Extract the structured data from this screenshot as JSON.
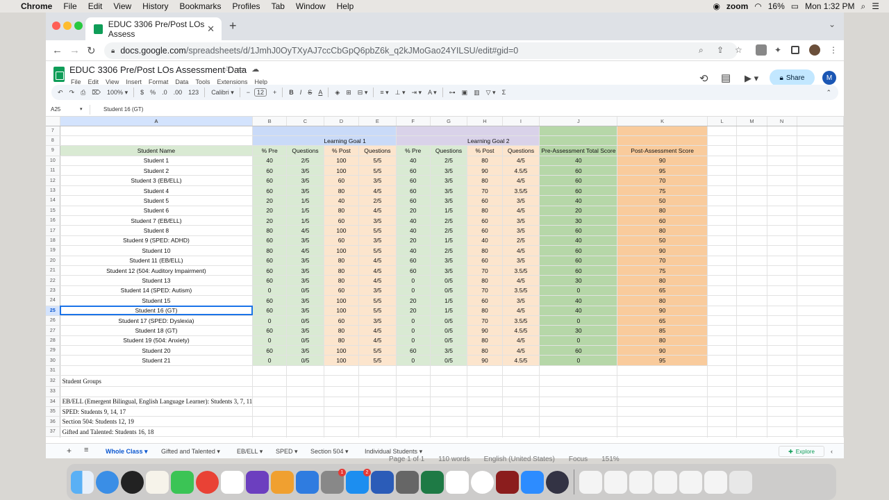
{
  "menubar": {
    "apple": "",
    "app": "Chrome",
    "items": [
      "File",
      "Edit",
      "View",
      "History",
      "Bookmarks",
      "Profiles",
      "Tab",
      "Window",
      "Help"
    ],
    "zoom": "zoom",
    "battery": "16%",
    "clock": "Mon 1:32 PM"
  },
  "browser": {
    "tab_title": "EDUC 3306 Pre/Post LOs Assess",
    "url_host": "docs.google.com",
    "url_rest": "/spreadsheets/d/1JmhJ0OyTXyAJ7ccCbGpQ6pbZ6k_q2kJMoGao24YILSU/edit#gid=0",
    "avatar": "M"
  },
  "sheets": {
    "title": "EDUC 3306 Pre/Post LOs Assessment Data",
    "menus": [
      "File",
      "Edit",
      "View",
      "Insert",
      "Format",
      "Data",
      "Tools",
      "Extensions",
      "Help"
    ],
    "share": "Share",
    "zoom": "100%",
    "font": "Calibri",
    "font_size": "12",
    "toolbar": [
      "$",
      "%",
      ".0",
      ".00",
      "123"
    ],
    "name_box": "A25",
    "formula": "Student 16 (GT)"
  },
  "grid": {
    "columns": [
      "A",
      "B",
      "C",
      "D",
      "E",
      "F",
      "G",
      "H",
      "I",
      "J",
      "K",
      "L",
      "M",
      "N"
    ],
    "row7": "7",
    "row8": "8",
    "row9": "9",
    "goal1": "Learning Goal 1",
    "goal2": "Learning Goal 2",
    "headers": [
      "Student Name",
      "% Pre",
      "Questions",
      "% Post",
      "Questions",
      "% Pre",
      "Questions",
      "% Post",
      "Questions",
      "Pre-Assessment Total Score",
      "Post-Assessment Score"
    ],
    "students": [
      {
        "row": "10",
        "name": "Student 1",
        "v": [
          "40",
          "2/5",
          "100",
          "5/5",
          "40",
          "2/5",
          "80",
          "4/5",
          "40",
          "90"
        ]
      },
      {
        "row": "11",
        "name": "Student 2",
        "v": [
          "60",
          "3/5",
          "100",
          "5/5",
          "60",
          "3/5",
          "90",
          "4.5/5",
          "60",
          "95"
        ]
      },
      {
        "row": "12",
        "name": "Student 3 (EB/ELL)",
        "v": [
          "60",
          "3/5",
          "60",
          "3/5",
          "60",
          "3/5",
          "80",
          "4/5",
          "60",
          "70"
        ]
      },
      {
        "row": "13",
        "name": "Student 4",
        "v": [
          "60",
          "3/5",
          "80",
          "4/5",
          "60",
          "3/5",
          "70",
          "3.5/5",
          "60",
          "75"
        ]
      },
      {
        "row": "14",
        "name": "Student 5",
        "v": [
          "20",
          "1/5",
          "40",
          "2/5",
          "60",
          "3/5",
          "60",
          "3/5",
          "40",
          "50"
        ]
      },
      {
        "row": "15",
        "name": "Student 6",
        "v": [
          "20",
          "1/5",
          "80",
          "4/5",
          "20",
          "1/5",
          "80",
          "4/5",
          "20",
          "80"
        ]
      },
      {
        "row": "16",
        "name": "Student 7 (EB/ELL)",
        "v": [
          "20",
          "1/5",
          "60",
          "3/5",
          "40",
          "2/5",
          "60",
          "3/5",
          "30",
          "60"
        ]
      },
      {
        "row": "17",
        "name": "Student 8",
        "v": [
          "80",
          "4/5",
          "100",
          "5/5",
          "40",
          "2/5",
          "60",
          "3/5",
          "60",
          "80"
        ]
      },
      {
        "row": "18",
        "name": "Student 9 (SPED: ADHD)",
        "v": [
          "60",
          "3/5",
          "60",
          "3/5",
          "20",
          "1/5",
          "40",
          "2/5",
          "40",
          "50"
        ]
      },
      {
        "row": "19",
        "name": "Student 10",
        "v": [
          "80",
          "4/5",
          "100",
          "5/5",
          "40",
          "2/5",
          "80",
          "4/5",
          "60",
          "90"
        ]
      },
      {
        "row": "20",
        "name": "Student 11 (EB/ELL)",
        "v": [
          "60",
          "3/5",
          "80",
          "4/5",
          "60",
          "3/5",
          "60",
          "3/5",
          "60",
          "70"
        ]
      },
      {
        "row": "21",
        "name": "Student 12 (504: Auditory Impairment)",
        "v": [
          "60",
          "3/5",
          "80",
          "4/5",
          "60",
          "3/5",
          "70",
          "3.5/5",
          "60",
          "75"
        ]
      },
      {
        "row": "22",
        "name": "Student 13",
        "v": [
          "60",
          "3/5",
          "80",
          "4/5",
          "0",
          "0/5",
          "80",
          "4/5",
          "30",
          "80"
        ]
      },
      {
        "row": "23",
        "name": "Student 14 (SPED: Autism)",
        "v": [
          "0",
          "0/5",
          "60",
          "3/5",
          "0",
          "0/5",
          "70",
          "3.5/5",
          "0",
          "65"
        ]
      },
      {
        "row": "24",
        "name": "Student 15",
        "v": [
          "60",
          "3/5",
          "100",
          "5/5",
          "20",
          "1/5",
          "60",
          "3/5",
          "40",
          "80"
        ]
      },
      {
        "row": "25",
        "name": "Student 16 (GT)",
        "v": [
          "60",
          "3/5",
          "100",
          "5/5",
          "20",
          "1/5",
          "80",
          "4/5",
          "40",
          "90"
        ]
      },
      {
        "row": "26",
        "name": "Student 17 (SPED: Dyslexia)",
        "v": [
          "0",
          "0/5",
          "60",
          "3/5",
          "0",
          "0/5",
          "70",
          "3.5/5",
          "0",
          "65"
        ]
      },
      {
        "row": "27",
        "name": "Student 18 (GT)",
        "v": [
          "60",
          "3/5",
          "80",
          "4/5",
          "0",
          "0/5",
          "90",
          "4.5/5",
          "30",
          "85"
        ]
      },
      {
        "row": "28",
        "name": "Student 19 (504: Anxiety)",
        "v": [
          "0",
          "0/5",
          "80",
          "4/5",
          "0",
          "0/5",
          "80",
          "4/5",
          "0",
          "80"
        ]
      },
      {
        "row": "29",
        "name": "Student 20",
        "v": [
          "60",
          "3/5",
          "100",
          "5/5",
          "60",
          "3/5",
          "80",
          "4/5",
          "60",
          "90"
        ]
      },
      {
        "row": "30",
        "name": "Student 21",
        "v": [
          "0",
          "0/5",
          "100",
          "5/5",
          "0",
          "0/5",
          "90",
          "4.5/5",
          "0",
          "95"
        ]
      }
    ],
    "notes": [
      {
        "row": "31",
        "text": ""
      },
      {
        "row": "32",
        "text": "Student Groups"
      },
      {
        "row": "33",
        "text": ""
      },
      {
        "row": "34",
        "text": "EB/ELL (Emergent Bilingual, English Language Learner): Students 3, 7, 11"
      },
      {
        "row": "35",
        "text": "SPED: Students 9, 14, 17"
      },
      {
        "row": "36",
        "text": "Section 504: Students 12, 19"
      },
      {
        "row": "37",
        "text": "Gifted and Talented: Students 16, 18"
      },
      {
        "row": "38",
        "text": ""
      }
    ]
  },
  "sheet_tabs": [
    "Whole Class",
    "Gifted and Talented",
    "EB/ELL",
    "SPED",
    "Section 504",
    "Individual Students"
  ],
  "explore": "Explore",
  "background_doc": [
    "Page 1 of 1",
    "110 words",
    "English (United States)",
    "Focus",
    "151%"
  ],
  "colors": {
    "green": "#d9ead3",
    "orange": "#fce5cd",
    "blue": "#c9daf8",
    "purple": "#d9d2e9",
    "accent": "#0b57d0"
  }
}
